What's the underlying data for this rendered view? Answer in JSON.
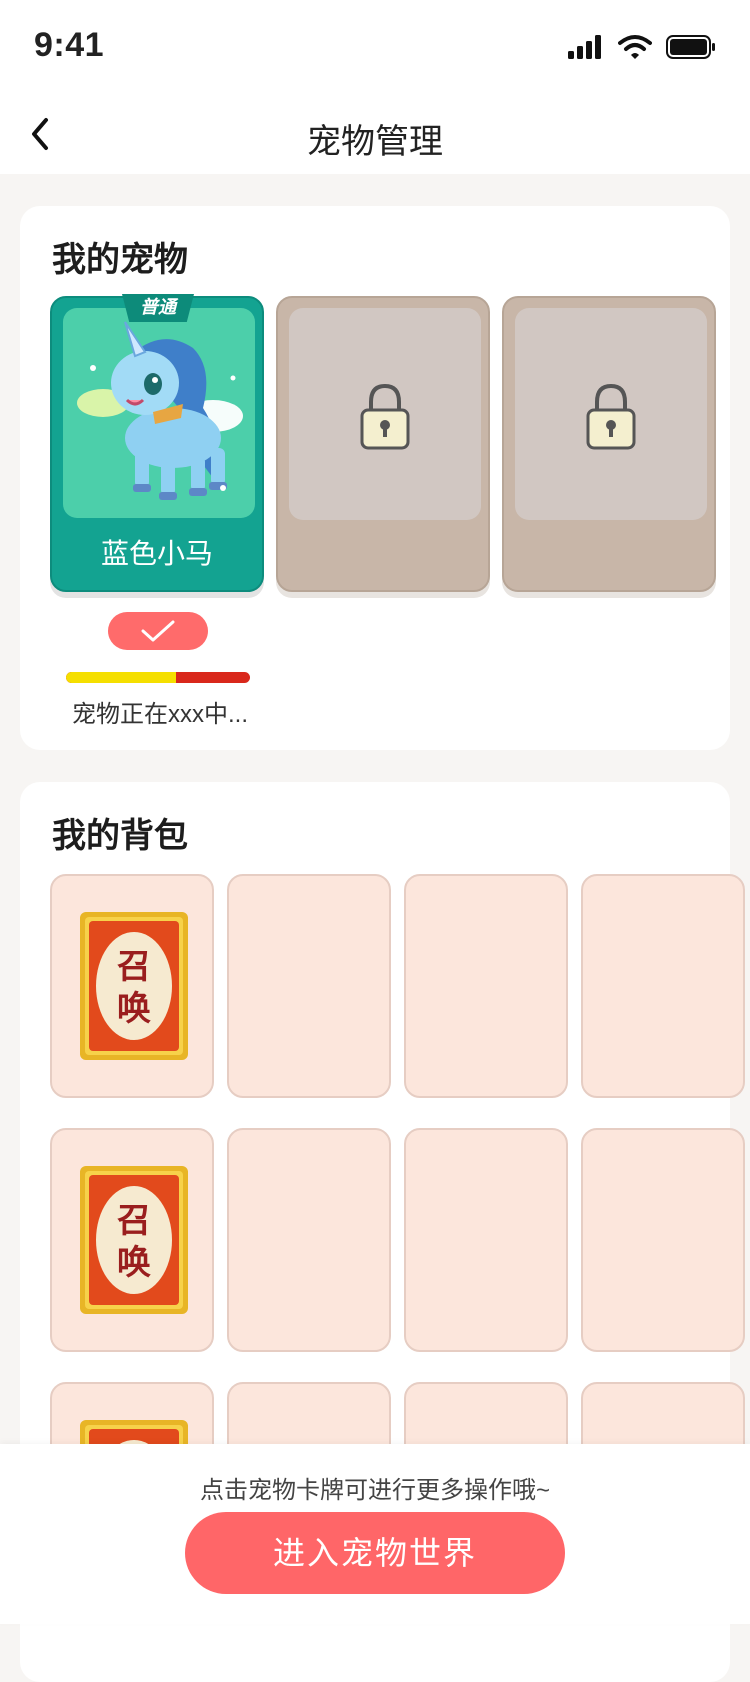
{
  "status_bar": {
    "time": "9:41"
  },
  "nav": {
    "title": "宠物管理"
  },
  "my_pets": {
    "title": "我的宠物",
    "active_pet": {
      "tier": "普通",
      "name": "蓝色小马",
      "progress": 0.6,
      "status_text": "宠物正在xxx中..."
    },
    "locked_slots": 2
  },
  "backpack": {
    "title": "我的背包",
    "item_label_top": "召",
    "item_label_bottom": "唤"
  },
  "footer": {
    "hint": "点击宠物卡牌可进行更多操作哦~",
    "enter_button": "进入宠物世界"
  },
  "colors": {
    "accent": "#ff6668",
    "pet_card": "#13a391",
    "locked_card": "#c8b6a8",
    "slot_bg": "#fce6dc"
  }
}
